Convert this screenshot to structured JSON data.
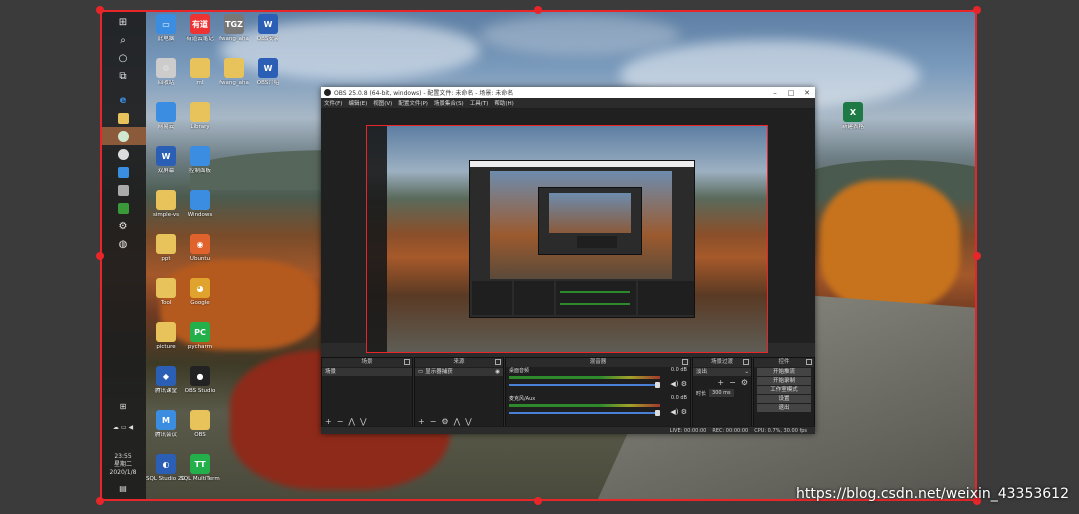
{
  "taskbar": {
    "clock_time": "23:55",
    "clock_weekday": "星期二",
    "clock_date": "2020/1/8"
  },
  "desktop_icons": [
    {
      "label": "此电脑",
      "color": "#3a8de0",
      "glyph": "▭"
    },
    {
      "label": "有道云笔记",
      "color": "#e33",
      "glyph": "有道"
    },
    {
      "label": "fwang_aha",
      "color": "#777",
      "glyph": "TGZ"
    },
    {
      "label": "OBS安装",
      "color": "#2b5fb5",
      "glyph": "W"
    },
    {
      "label": "回收站",
      "color": "#ccc",
      "glyph": "♲"
    },
    {
      "label": "ml",
      "color": "#e8c25a",
      "glyph": ""
    },
    {
      "label": "fwang_aha",
      "color": "#e8c25a",
      "glyph": ""
    },
    {
      "label": "OBS介绍",
      "color": "#2b5fb5",
      "glyph": "W"
    },
    {
      "label": "网易云",
      "color": "#3a8de0",
      "glyph": ""
    },
    {
      "label": "Library",
      "color": "#e8c25a",
      "glyph": ""
    },
    {
      "label": "双屏幕",
      "color": "#2b5fb5",
      "glyph": "W"
    },
    {
      "label": "控制面板",
      "color": "#3a8de0",
      "glyph": ""
    },
    {
      "label": "simple-vs",
      "color": "#e8c25a",
      "glyph": ""
    },
    {
      "label": "Windows",
      "color": "#3a8de0",
      "glyph": ""
    },
    {
      "label": "ppt",
      "color": "#e8c25a",
      "glyph": ""
    },
    {
      "label": "Ubuntu",
      "color": "#e0632e",
      "glyph": "◉"
    },
    {
      "label": "Tool",
      "color": "#e8c25a",
      "glyph": ""
    },
    {
      "label": "Google",
      "color": "#e0a32e",
      "glyph": "◕"
    },
    {
      "label": "picture",
      "color": "#e8c25a",
      "glyph": ""
    },
    {
      "label": "pycharm",
      "color": "#23b04a",
      "glyph": "PC"
    },
    {
      "label": "腾讯课堂",
      "color": "#2b5fb5",
      "glyph": "◆"
    },
    {
      "label": "OBS Studio",
      "color": "#222",
      "glyph": "●"
    },
    {
      "label": "腾讯会议",
      "color": "#3a8de0",
      "glyph": "M"
    },
    {
      "label": "OBS",
      "color": "#e8c25a",
      "glyph": ""
    },
    {
      "label": "SQL Studio 2017",
      "color": "#2b5fb5",
      "glyph": "◐"
    },
    {
      "label": "SQL MultiTerm",
      "color": "#23b04a",
      "glyph": "TT"
    }
  ],
  "excel_icon": {
    "label": "新建表格",
    "color": "#1d7a45",
    "glyph": "X"
  },
  "obs": {
    "title": "OBS 25.0.8 (64-bit, windows) - 配置文件: 未命名 - 场景: 未命名",
    "menu": [
      "文件(F)",
      "编辑(E)",
      "视图(V)",
      "配置文件(P)",
      "场景集合(S)",
      "工具(T)",
      "帮助(H)"
    ],
    "docks": {
      "scenes": {
        "title": "场景",
        "items": [
          "场景"
        ]
      },
      "sources": {
        "title": "来源",
        "items": [
          "显示器捕获"
        ]
      },
      "mixer": {
        "title": "混音器",
        "channels": [
          {
            "name": "桌面音频",
            "value": "0.0 dB"
          },
          {
            "name": "麦克风/Aux",
            "value": "0.0 dB"
          }
        ]
      },
      "transitions": {
        "title": "场景过渡",
        "type": "淡出",
        "duration_label": "时长",
        "duration": "300 ms"
      },
      "controls": {
        "title": "控件",
        "buttons": [
          "开始推流",
          "开始录制",
          "工作室模式",
          "设置",
          "退出"
        ]
      }
    },
    "status": {
      "live": "LIVE: 00:00:00",
      "rec": "REC: 00:00:00",
      "cpu": "CPU: 0.7%, 30.00 fps"
    }
  },
  "watermark": "https://blog.csdn.net/weixin_43353612"
}
